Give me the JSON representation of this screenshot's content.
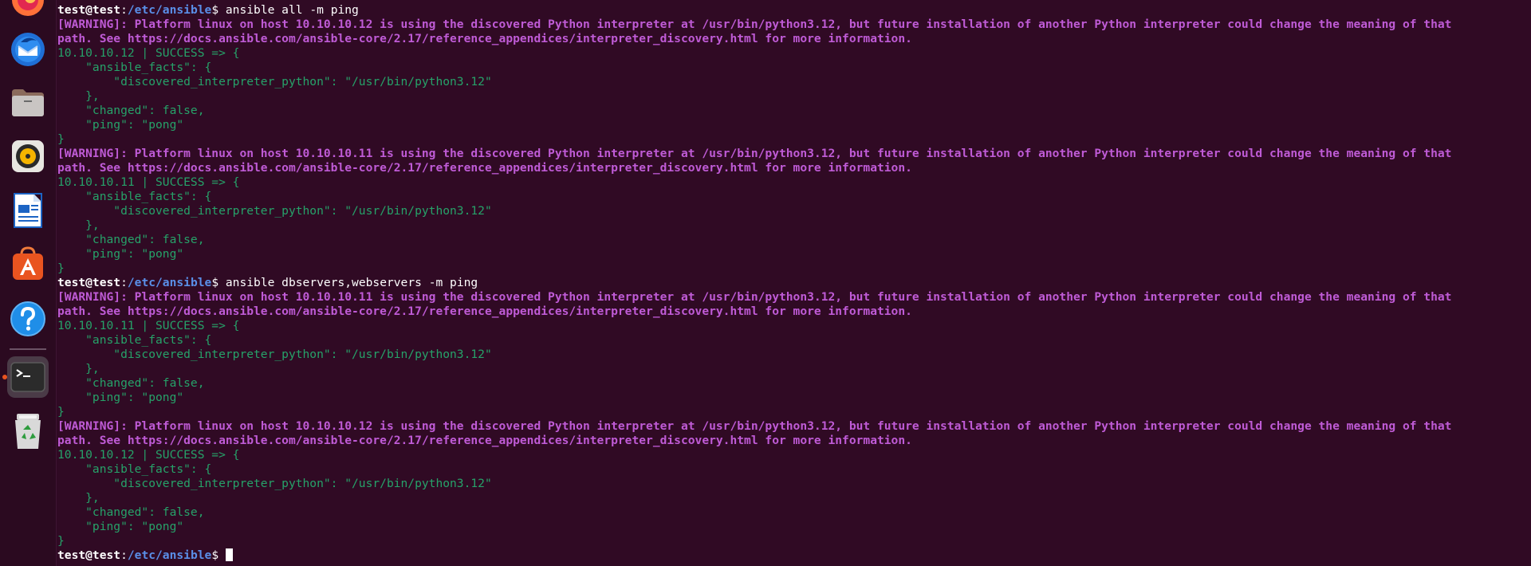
{
  "dock": {
    "apps": [
      {
        "name": "firefox-icon"
      },
      {
        "name": "thunderbird-icon"
      },
      {
        "name": "files-icon"
      },
      {
        "name": "rhythmbox-icon"
      },
      {
        "name": "writer-icon"
      },
      {
        "name": "app-center-icon"
      },
      {
        "name": "help-icon"
      },
      {
        "name": "terminal-icon"
      },
      {
        "name": "trash-icon"
      }
    ],
    "accent_color": "#e95420"
  },
  "terminal": {
    "colors": {
      "background": "#300a24",
      "warning": "#bf5bd6",
      "success": "#26a269",
      "path": "#5a8fe8",
      "text": "#ffffff"
    },
    "prompt": {
      "user_host": "test@test",
      "colon": ":",
      "path": "/etc/ansible",
      "dollar": "$"
    },
    "blocks": [
      {
        "command": " ansible all -m ping",
        "results": [
          {
            "warning": [
              "[WARNING]: Platform linux on host 10.10.10.12 is using the discovered Python interpreter at /usr/bin/python3.12, but future installation of another Python interpreter could change the meaning of that",
              "path. See https://docs.ansible.com/ansible-core/2.17/reference_appendices/interpreter_discovery.html for more information."
            ],
            "output": [
              "10.10.10.12 | SUCCESS => {",
              "    \"ansible_facts\": {",
              "        \"discovered_interpreter_python\": \"/usr/bin/python3.12\"",
              "    },",
              "    \"changed\": false,",
              "    \"ping\": \"pong\"",
              "}"
            ]
          },
          {
            "warning": [
              "[WARNING]: Platform linux on host 10.10.10.11 is using the discovered Python interpreter at /usr/bin/python3.12, but future installation of another Python interpreter could change the meaning of that",
              "path. See https://docs.ansible.com/ansible-core/2.17/reference_appendices/interpreter_discovery.html for more information."
            ],
            "output": [
              "10.10.10.11 | SUCCESS => {",
              "    \"ansible_facts\": {",
              "        \"discovered_interpreter_python\": \"/usr/bin/python3.12\"",
              "    },",
              "    \"changed\": false,",
              "    \"ping\": \"pong\"",
              "}"
            ]
          }
        ]
      },
      {
        "command": " ansible dbservers,webservers -m ping",
        "results": [
          {
            "warning": [
              "[WARNING]: Platform linux on host 10.10.10.11 is using the discovered Python interpreter at /usr/bin/python3.12, but future installation of another Python interpreter could change the meaning of that",
              "path. See https://docs.ansible.com/ansible-core/2.17/reference_appendices/interpreter_discovery.html for more information."
            ],
            "output": [
              "10.10.10.11 | SUCCESS => {",
              "    \"ansible_facts\": {",
              "        \"discovered_interpreter_python\": \"/usr/bin/python3.12\"",
              "    },",
              "    \"changed\": false,",
              "    \"ping\": \"pong\"",
              "}"
            ]
          },
          {
            "warning": [
              "[WARNING]: Platform linux on host 10.10.10.12 is using the discovered Python interpreter at /usr/bin/python3.12, but future installation of another Python interpreter could change the meaning of that",
              "path. See https://docs.ansible.com/ansible-core/2.17/reference_appendices/interpreter_discovery.html for more information."
            ],
            "output": [
              "10.10.10.12 | SUCCESS => {",
              "    \"ansible_facts\": {",
              "        \"discovered_interpreter_python\": \"/usr/bin/python3.12\"",
              "    },",
              "    \"changed\": false,",
              "    \"ping\": \"pong\"",
              "}"
            ]
          }
        ]
      }
    ],
    "final_prompt_command": " "
  }
}
